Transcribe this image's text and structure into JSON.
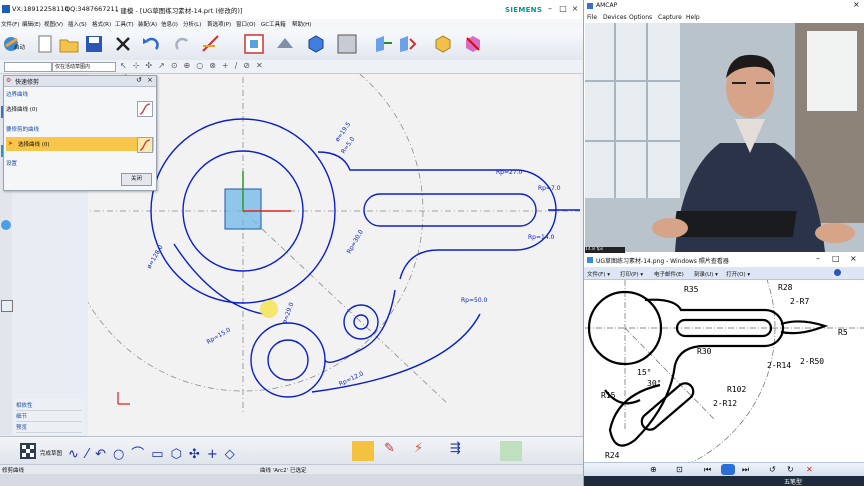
{
  "nx": {
    "title_left": "VX:18912258110",
    "title_qq": "QQ:3487667211",
    "title_main": "- 建模 - [UG草图练习素材-14.prt  (修改的)]",
    "brand": "SIEMENS",
    "menu": [
      "文件(F)",
      "编辑(E)",
      "视图(V)",
      "插入(S)",
      "格式(R)",
      "工具(T)",
      "装配(A)",
      "信息(I)",
      "分析(L)",
      "首选项(P)",
      "窗口(O)",
      "GC工具箱",
      "帮助(H)"
    ],
    "start_label": "启动",
    "filter_left": "",
    "filter_right": "仅在活动草图内",
    "dialog": {
      "title": "快速修剪",
      "section1": "边界曲线",
      "select1": "选择曲线 (0)",
      "section2": "要修剪的曲线",
      "select2": "选择曲线 (0)",
      "section3": "设置",
      "close_button": "关闭"
    },
    "panel2": [
      "相依性",
      "细节",
      "预览"
    ],
    "bottom_tb_label": "完成草图",
    "status_left": "修剪曲线",
    "status_center": "曲线 'Arc2' 已选定",
    "dimensions": {
      "d1": "ø=19.5",
      "d2": "R=5.0",
      "d3": "Rp=27.0",
      "d4": "Rp=7.0",
      "d5": "Rp=14.0",
      "d6": "Rp=30.0",
      "d7": "ø=29.0",
      "d8": "ø=128.0",
      "d9": "Rp=15.0",
      "d10": "Rp=12.0",
      "d11": "Rp=50.0"
    }
  },
  "amcap": {
    "title": "AMCAP",
    "menu": [
      "File",
      "Devices",
      "Options",
      "Capture",
      "Help"
    ],
    "status": "14.8 fps"
  },
  "viewer": {
    "title": "UG草图练习素材-14.png - Windows 照片查看器",
    "menu": [
      "文件(F) ▾",
      "打印(P) ▾",
      "电子邮件(E)",
      "刻录(U) ▾",
      "打开(O) ▾"
    ],
    "labels": {
      "r35": "R35",
      "r28": "R28",
      "r7": "2-R7",
      "r5": "R5",
      "r30": "R30",
      "r14": "2-R14",
      "r50": "2-R50",
      "a15": "15°",
      "a30": "30°",
      "r102": "R102",
      "r12": "2-R12",
      "r15": "R15",
      "r24": "R24"
    },
    "taskbar_text": "五笔型"
  },
  "colors": {
    "sketch_blue": "#0a1fc8",
    "dialog_highlight": "#f7c64a",
    "section_blue": "#1a4fa0",
    "brand_teal": "#009999"
  }
}
